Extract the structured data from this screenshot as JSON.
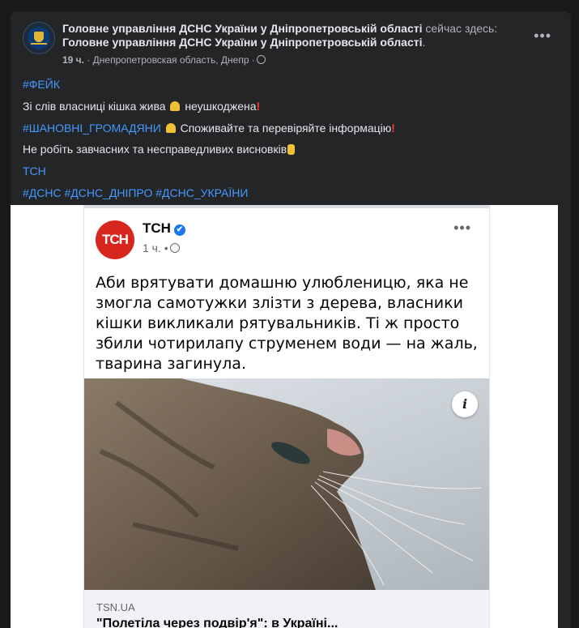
{
  "post": {
    "author": "Головне управління ДСНС України у Дніпропетровській області",
    "status_text": "сейчас здесь:",
    "location_page": "Головне управління ДСНС України у Дніпропетровській області",
    "time": "19 ч.",
    "place": "Днепропетровская область, Днепр",
    "lines": {
      "l1_tag": "#ФЕЙК",
      "l2_text": "Зі слів власниці кішка жива",
      "l2_text_b": "неушкоджена",
      "l3_tag": "#ШАНОВНІ_ГРОМАДЯНИ",
      "l3_text": "Споживайте та перевіряйте інформацію",
      "l4_text": "Не робіть завчасних та несправедливих висновків",
      "l5_tag": "ТСН",
      "l6_tags": "#ДСНС #ДСНС_ДНІПРО #ДСНС_УКРАЇНИ"
    },
    "more_label": "•••"
  },
  "shared": {
    "logo_text": "ТСН",
    "page_name": "ТСН",
    "verified": "✔",
    "time": "1 ч. •",
    "more_label": "•••",
    "text": "Аби врятувати домашню улюбленицю, яка не змогла самотужки злізти з дерева, власники кішки викликали рятувальників. Ті ж просто збили чотирилапу струменем води — на жаль, тварина загинула.",
    "info_label": "i",
    "link_domain": "TSN.UA",
    "link_title": "\"Полетіла через подвір'я\": в Україні..."
  },
  "icons": {
    "globe": "globe-icon",
    "pray": "folded-hands-emoji",
    "exclamation": "red-exclamation-emoji",
    "hand": "pointing-hand-emoji",
    "verified": "verified-badge-icon",
    "info": "info-icon"
  },
  "colors": {
    "background": "#18191a",
    "card": "#242526",
    "hashtag": "#4599ff",
    "verified": "#1877f2",
    "tsn_red": "#d7261e"
  }
}
